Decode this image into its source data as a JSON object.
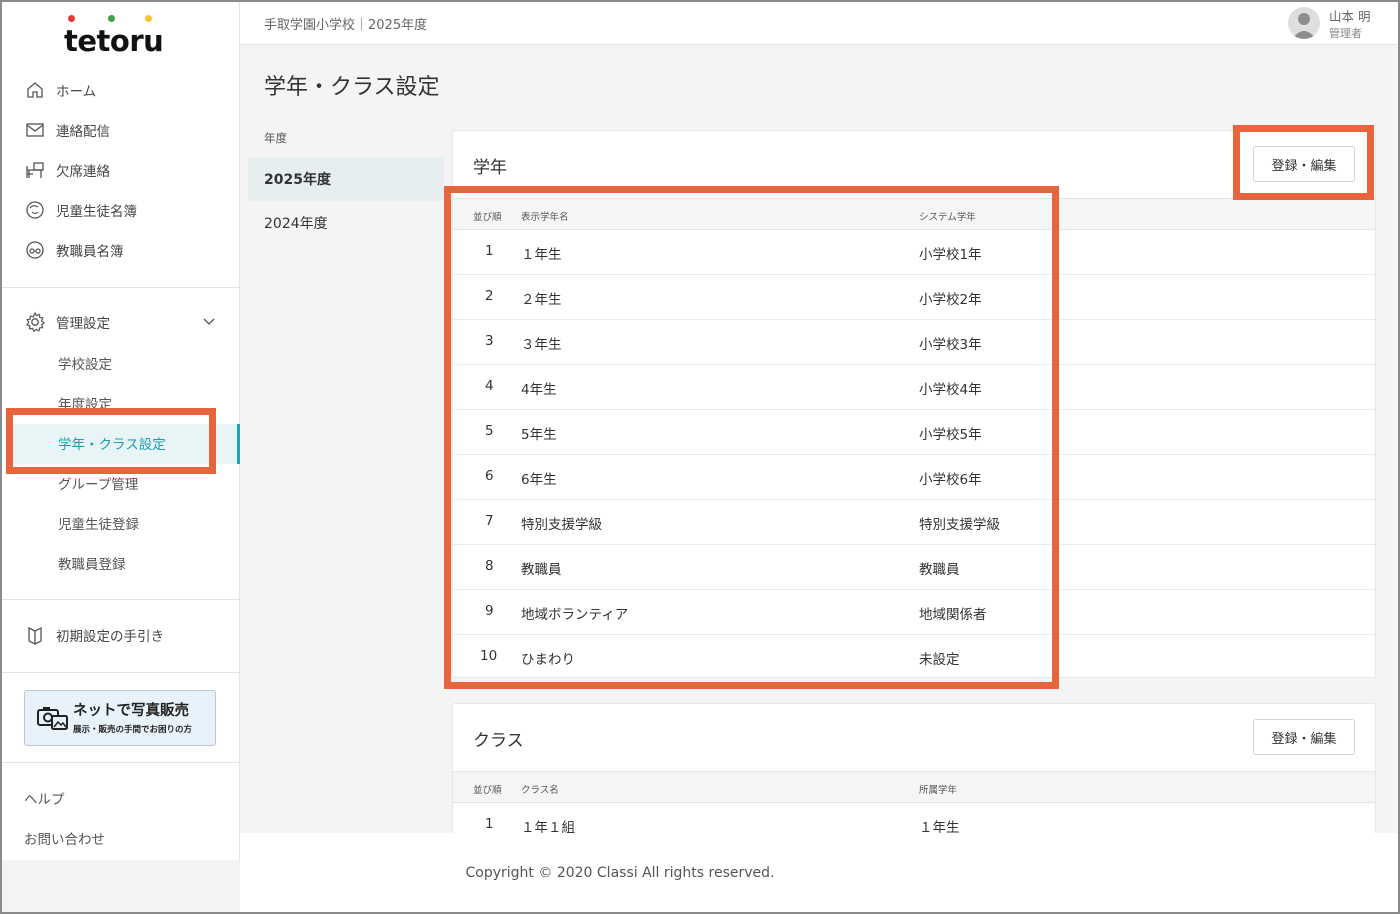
{
  "brand": {
    "logo_text": "tetoru",
    "dot_colors": [
      "#e53935",
      "#43a047",
      "#fbc02d"
    ]
  },
  "header": {
    "school_year": "手取学園小学校｜2025年度",
    "user_name": "山本 明",
    "user_role": "管理者"
  },
  "sidebar": {
    "nav": [
      {
        "label": "ホーム",
        "icon": "home-icon"
      },
      {
        "label": "連絡配信",
        "icon": "mail-icon"
      },
      {
        "label": "欠席連絡",
        "icon": "desk-icon"
      },
      {
        "label": "児童生徒名簿",
        "icon": "student-icon"
      },
      {
        "label": "教職員名簿",
        "icon": "teacher-icon"
      }
    ],
    "admin": {
      "label": "管理設定",
      "icon": "gear-icon",
      "expanded": true
    },
    "admin_items": [
      {
        "label": "学校設定"
      },
      {
        "label": "年度設定"
      },
      {
        "label": "学年・クラス設定",
        "active": true
      },
      {
        "label": "グループ管理"
      },
      {
        "label": "児童生徒登録"
      },
      {
        "label": "教職員登録"
      }
    ],
    "guide": {
      "label": "初期設定の手引き",
      "icon": "book-icon"
    },
    "promo": {
      "line1": "ネットで写真販売",
      "line2": "展示・販売の手間でお困りの方"
    },
    "help": "ヘルプ",
    "contact": "お問い合わせ"
  },
  "page": {
    "title": "学年・クラス設定"
  },
  "years": {
    "label": "年度",
    "items": [
      {
        "label": "2025年度",
        "active": true
      },
      {
        "label": "2024年度",
        "active": false
      }
    ]
  },
  "grades": {
    "title": "学年",
    "edit_button": "登録・編集",
    "columns": [
      "並び順",
      "表示学年名",
      "システム学年"
    ],
    "rows": [
      {
        "order": "1",
        "name": "１年生",
        "system": "小学校1年"
      },
      {
        "order": "2",
        "name": "２年生",
        "system": "小学校2年"
      },
      {
        "order": "3",
        "name": "３年生",
        "system": "小学校3年"
      },
      {
        "order": "4",
        "name": "4年生",
        "system": "小学校4年"
      },
      {
        "order": "5",
        "name": "5年生",
        "system": "小学校5年"
      },
      {
        "order": "6",
        "name": "6年生",
        "system": "小学校6年"
      },
      {
        "order": "7",
        "name": "特別支援学級",
        "system": "特別支援学級"
      },
      {
        "order": "8",
        "name": "教職員",
        "system": "教職員"
      },
      {
        "order": "9",
        "name": "地域ボランティア",
        "system": "地域関係者"
      },
      {
        "order": "10",
        "name": "ひまわり",
        "system": "未設定"
      }
    ]
  },
  "classes": {
    "title": "クラス",
    "edit_button": "登録・編集",
    "columns": [
      "並び順",
      "クラス名",
      "所属学年"
    ],
    "rows": [
      {
        "order": "1",
        "name": "１年１組",
        "grade": "１年生"
      }
    ]
  },
  "footer": {
    "copyright": "Copyright © 2020 Classi All rights reserved."
  },
  "highlight_color": "#e8643c"
}
